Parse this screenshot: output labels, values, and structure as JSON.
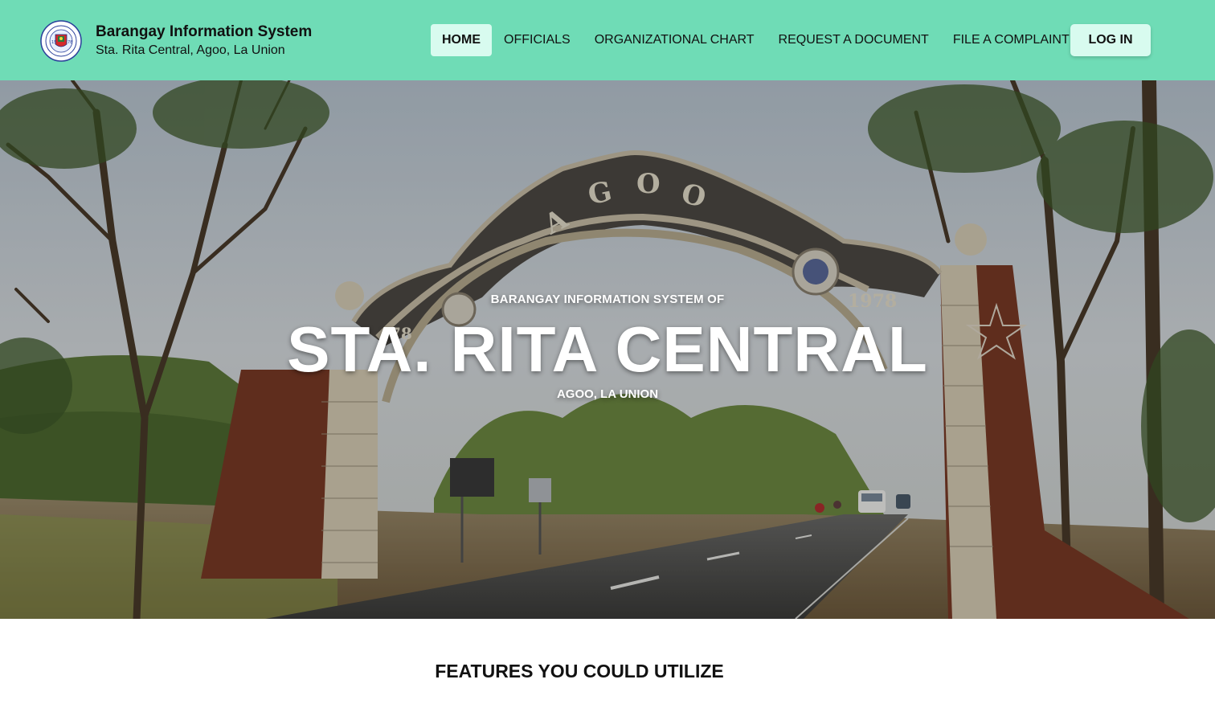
{
  "header": {
    "title": "Barangay Information System",
    "subtitle": "Sta. Rita Central, Agoo, La Union",
    "seal_icon": "municipality-of-agoo-seal",
    "background": "#6fdcb6",
    "nav": [
      {
        "label": "HOME",
        "active": true
      },
      {
        "label": "OFFICIALS",
        "active": false
      },
      {
        "label": "ORGANIZATIONAL CHART",
        "active": false
      },
      {
        "label": "REQUEST A DOCUMENT",
        "active": false
      },
      {
        "label": "FILE A COMPLAINT",
        "active": false
      }
    ],
    "login_label": "LOG IN",
    "button_bg": "#d8fbef"
  },
  "hero": {
    "kicker": "BARANGAY INFORMATION SYSTEM OF",
    "title": "STA. RITA CENTRAL",
    "subtitle": "AGOO, LA UNION",
    "arch_text": "AGOO",
    "arch_year": "1978"
  },
  "features": {
    "title": "FEATURES YOU COULD UTILIZE"
  }
}
